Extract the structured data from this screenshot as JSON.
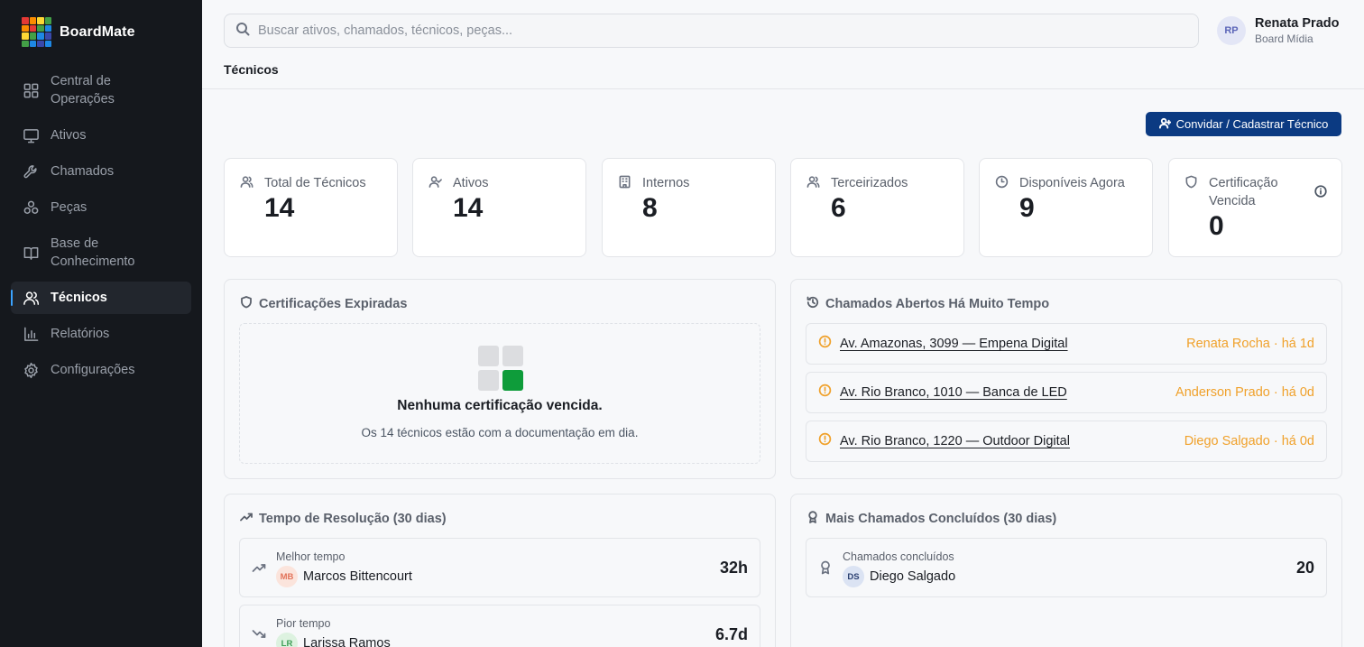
{
  "brand": {
    "name": "BoardMate"
  },
  "sidebar": {
    "items": [
      {
        "label": "Central de Operações",
        "icon": "dashboard-icon"
      },
      {
        "label": "Ativos",
        "icon": "monitor-icon"
      },
      {
        "label": "Chamados",
        "icon": "wrench-icon"
      },
      {
        "label": "Peças",
        "icon": "parts-icon"
      },
      {
        "label": "Base de Conhecimento",
        "icon": "book-icon"
      },
      {
        "label": "Técnicos",
        "icon": "users-icon",
        "active": true
      },
      {
        "label": "Relatórios",
        "icon": "bar-chart-icon"
      },
      {
        "label": "Configurações",
        "icon": "gear-icon"
      }
    ]
  },
  "search": {
    "placeholder": "Buscar ativos, chamados, técnicos, peças..."
  },
  "user": {
    "initials": "RP",
    "name": "Renata Prado",
    "org": "Board Mídia"
  },
  "breadcrumb": "Técnicos",
  "actions": {
    "invite_label": "Convidar / Cadastrar Técnico"
  },
  "stats": [
    {
      "label": "Total de Técnicos",
      "value": "14",
      "icon": "users-icon"
    },
    {
      "label": "Ativos",
      "value": "14",
      "icon": "user-check-icon"
    },
    {
      "label": "Internos",
      "value": "8",
      "icon": "building-icon"
    },
    {
      "label": "Terceirizados",
      "value": "6",
      "icon": "users-icon"
    },
    {
      "label": "Disponíveis Agora",
      "value": "9",
      "icon": "clock-icon"
    },
    {
      "label": "Certificação Vencida",
      "value": "0",
      "icon": "shield-icon"
    }
  ],
  "certifications": {
    "title": "Certificações Expiradas",
    "empty_title": "Nenhuma certificação vencida.",
    "empty_sub": "Os 14 técnicos estão com a documentação em dia."
  },
  "old_tickets": {
    "title": "Chamados Abertos Há Muito Tempo",
    "items": [
      {
        "address": "Av. Amazonas, 3099 — Empena Digital",
        "meta": "Renata Rocha · há 1d"
      },
      {
        "address": "Av. Rio Branco, 1010 — Banca de LED",
        "meta": "Anderson Prado · há 0d"
      },
      {
        "address": "Av. Rio Branco, 1220 — Outdoor Digital",
        "meta": "Diego Salgado · há 0d"
      }
    ]
  },
  "resolution": {
    "title": "Tempo de Resolução (30 dias)",
    "best": {
      "label": "Melhor tempo",
      "initials": "MB",
      "name": "Marcos Bittencourt",
      "value": "32h"
    },
    "worst": {
      "label": "Pior tempo",
      "initials": "LR",
      "name": "Larissa Ramos",
      "value": "6.7d"
    }
  },
  "completed": {
    "title": "Mais Chamados Concluídos (30 dias)",
    "top": {
      "label": "Chamados concluídos",
      "initials": "DS",
      "name": "Diego Salgado",
      "value": "20"
    }
  },
  "colors": {
    "sidebar_bg": "#15181d",
    "primary_button": "#0b3a82",
    "warning": "#f0a12b",
    "success": "#0e9c3a",
    "active_indicator": "#3ba3ff"
  }
}
